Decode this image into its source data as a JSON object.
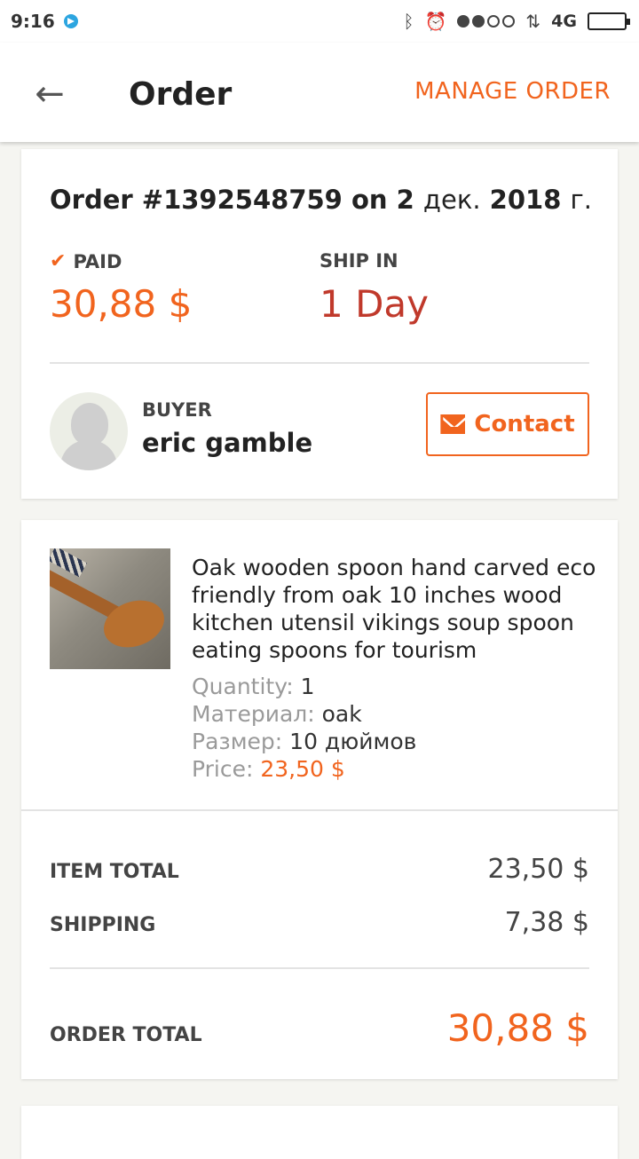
{
  "status_bar": {
    "time": "9:16",
    "network": "4G",
    "icons": [
      "telegram-icon",
      "bluetooth-icon",
      "alarm-icon",
      "signal-dots-icon",
      "signal-icon",
      "battery-icon"
    ]
  },
  "app_bar": {
    "title": "Order",
    "manage_label": "MANAGE ORDER",
    "back_icon": "arrow-left-icon"
  },
  "order": {
    "number_prefix": "Order #1392548759 on 2",
    "month": "дек.",
    "year": "2018",
    "year_suffix": "г.",
    "paid_label": "PAID",
    "paid_value": "30,88 $",
    "ship_label": "SHIP IN",
    "ship_value": "1 Day"
  },
  "buyer": {
    "label": "BUYER",
    "name": "eric gamble",
    "contact_label": "Contact"
  },
  "item": {
    "title": "Oak wooden spoon hand carved eco friendly from oak 10 inches wood kitchen utensil vikings soup spoon eating spoons for tourism",
    "attributes": [
      {
        "key": "Quantity: ",
        "value": "1"
      },
      {
        "key": "Материал: ",
        "value": "oak"
      },
      {
        "key": "Размер: ",
        "value": "10 дюймов"
      },
      {
        "key": "Price: ",
        "value": "23,50 $"
      }
    ]
  },
  "summary": {
    "item_total_label": "ITEM TOTAL",
    "item_total_value": "23,50 $",
    "shipping_label": "SHIPPING",
    "shipping_value": "7,38 $",
    "order_total_label": "ORDER TOTAL",
    "order_total_value": "30,88 $"
  },
  "colors": {
    "accent": "#f1641e",
    "ship_red": "#c0392b",
    "background": "#f5f5f1"
  }
}
